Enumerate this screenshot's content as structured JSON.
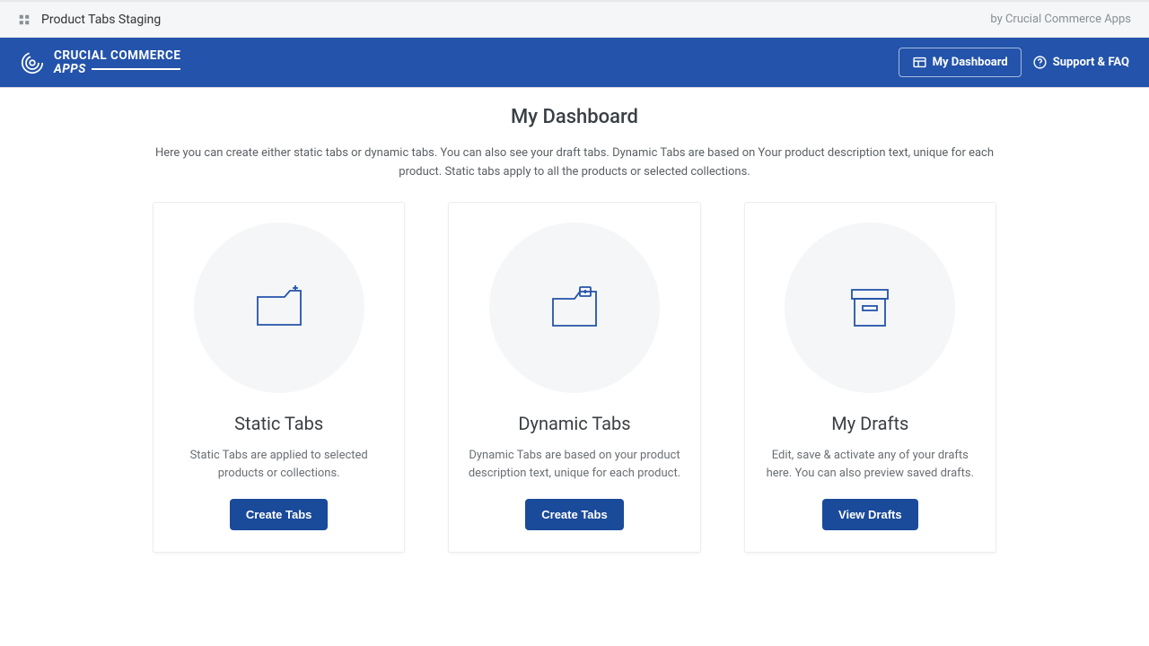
{
  "topbar": {
    "title": "Product Tabs Staging",
    "by": "by Crucial Commerce Apps"
  },
  "navbar": {
    "logo_line1": "CRUCIAL COMMERCE",
    "logo_line2": "APPS",
    "dashboard_btn": "My Dashboard",
    "support_link": "Support & FAQ"
  },
  "page": {
    "title": "My Dashboard",
    "description": "Here you can create either static tabs or dynamic tabs. You can also see your draft tabs. Dynamic Tabs are based on Your product description text, unique for each product. Static tabs apply to all the products or selected collections."
  },
  "cards": [
    {
      "title": "Static Tabs",
      "desc": "Static Tabs are applied to selected products or collections.",
      "button": "Create Tabs"
    },
    {
      "title": "Dynamic Tabs",
      "desc": "Dynamic Tabs are based on your product description text, unique for each product.",
      "button": "Create Tabs"
    },
    {
      "title": "My Drafts",
      "desc": "Edit, save & activate any of your drafts here. You can also preview saved drafts.",
      "button": "View Drafts"
    }
  ]
}
